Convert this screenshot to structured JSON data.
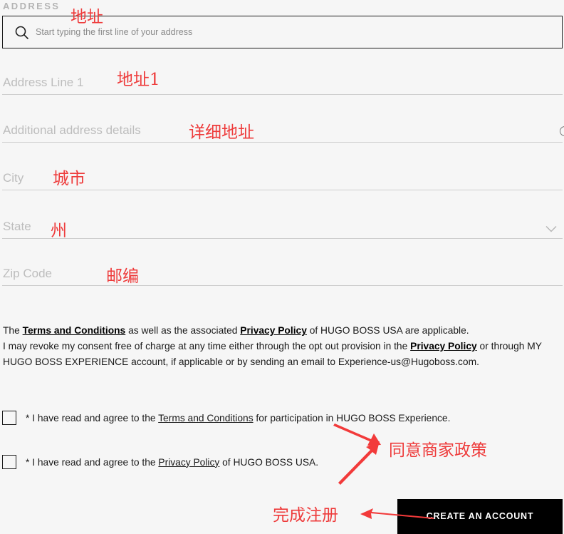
{
  "section": {
    "label": "ADDRESS"
  },
  "search": {
    "icon": "search-icon",
    "placeholder": "Start typing the first line of your address",
    "value": ""
  },
  "fields": [
    {
      "name": "address-line-1",
      "placeholder": "Address Line 1",
      "value": ""
    },
    {
      "name": "additional-address-details",
      "placeholder": "Additional address details",
      "value": "",
      "trailing_icon": "info-icon"
    },
    {
      "name": "city",
      "placeholder": "City",
      "value": ""
    },
    {
      "name": "state",
      "placeholder": "State",
      "value": "",
      "trailing_icon": "chevron-down-icon"
    },
    {
      "name": "zip-code",
      "placeholder": "Zip Code",
      "value": ""
    }
  ],
  "legal": {
    "p1_prefix": "The ",
    "terms_link": "Terms and Conditions",
    "p1_mid": " as well as the associated ",
    "privacy_link": "Privacy Policy",
    "p1_suffix": " of HUGO BOSS USA are applicable.",
    "p2_prefix": "I may revoke my consent free of charge at any time either through the opt out provision in the ",
    "p2_privacy_link": "Privacy Policy",
    "p2_suffix": " or through MY HUGO BOSS EXPERIENCE account, if applicable or by sending an email to Experience-us@Hugoboss.com."
  },
  "consents": [
    {
      "prefix": "* I have read and agree to the ",
      "link": "Terms and Conditions",
      "suffix": " for participation in HUGO BOSS Experience.",
      "checked": false
    },
    {
      "prefix": "* I have read and agree to the ",
      "link": "Privacy Policy",
      "suffix": " of HUGO BOSS USA.",
      "checked": false
    }
  ],
  "create_button": {
    "label": "CREATE AN ACCOUNT"
  },
  "annotations": {
    "address": "地址",
    "address_line_1": "地址1",
    "details": "详细地址",
    "city": "城市",
    "state": "州",
    "zip": "邮编",
    "agree_policies": "同意商家政策",
    "complete_registration": "完成注册",
    "color": "#ee3b3b"
  },
  "colors": {
    "background": "#f6f6f6",
    "button_bg": "#000000",
    "button_text": "#ffffff",
    "placeholder": "#bdbdbd",
    "annotation": "#ee3b3b"
  }
}
